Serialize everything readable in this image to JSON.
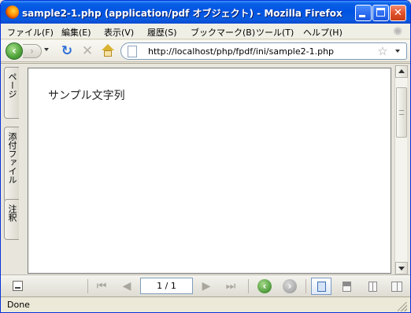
{
  "window": {
    "title": "sample2-1.php (application/pdf オブジェクト) - Mozilla Firefox",
    "app_icon": "firefox-logo-icon",
    "controls": {
      "minimize_icon": "minimize-icon",
      "maximize_icon": "maximize-icon",
      "close_icon": "close-icon",
      "close_glyph": "✕",
      "minimize_glyph": "",
      "maximize_glyph": ""
    }
  },
  "menubar": {
    "items": [
      "ファイル(F)",
      "編集(E)",
      "表示(V)",
      "履歴(S)",
      "ブックマーク(B)",
      "ツール(T)",
      "ヘルプ(H)"
    ],
    "throbber_icon": "loading-throbber-icon",
    "throbber_glyph": "✺"
  },
  "navbar": {
    "back_glyph": "‹",
    "forward_glyph": "›",
    "reload_glyph": "↻",
    "stop_glyph": "✕",
    "icons": {
      "back": "back-arrow-icon",
      "forward": "forward-arrow-icon",
      "history_dropdown": "history-dropdown-icon",
      "reload": "reload-icon",
      "stop": "stop-icon",
      "home": "home-icon",
      "site": "page-icon",
      "bookmark": "star-icon",
      "url_dropdown": "dropdown-arrow-icon"
    },
    "url": "http://localhost/php/fpdf/ini/sample2-1.php",
    "star_glyph": "☆"
  },
  "pdf_viewer": {
    "side_tabs": [
      "ページ",
      "添付ファイル",
      "注釈"
    ],
    "page_text": "サンプル文字列",
    "scrollbar": {
      "up_icon": "scroll-up-arrow-icon",
      "down_icon": "scroll-down-arrow-icon"
    },
    "toolbar": {
      "page_indicator": "1 / 1",
      "first_glyph": "⏮",
      "prev_glyph": "◀",
      "next_glyph": "▶",
      "last_glyph": "⏭",
      "zoom_out_glyph": "‹",
      "zoom_in_glyph": "›",
      "icons": {
        "panel_toggle": "panel-toggle-icon",
        "first": "first-page-icon",
        "prev": "previous-page-icon",
        "next": "next-page-icon",
        "last": "last-page-icon",
        "zoom_out": "zoom-out-icon",
        "zoom_in": "zoom-in-icon",
        "single": "single-page-view-icon",
        "split": "split-view-icon",
        "grid": "grid-view-icon",
        "dual": "two-page-view-icon"
      }
    }
  },
  "status": {
    "text": "Done"
  },
  "colors": {
    "titlebar": "#0054e3",
    "window_border": "#0831d9",
    "chrome_bg": "#ece9d8",
    "page_bg": "#ffffff",
    "url_border": "#7f9db9"
  }
}
